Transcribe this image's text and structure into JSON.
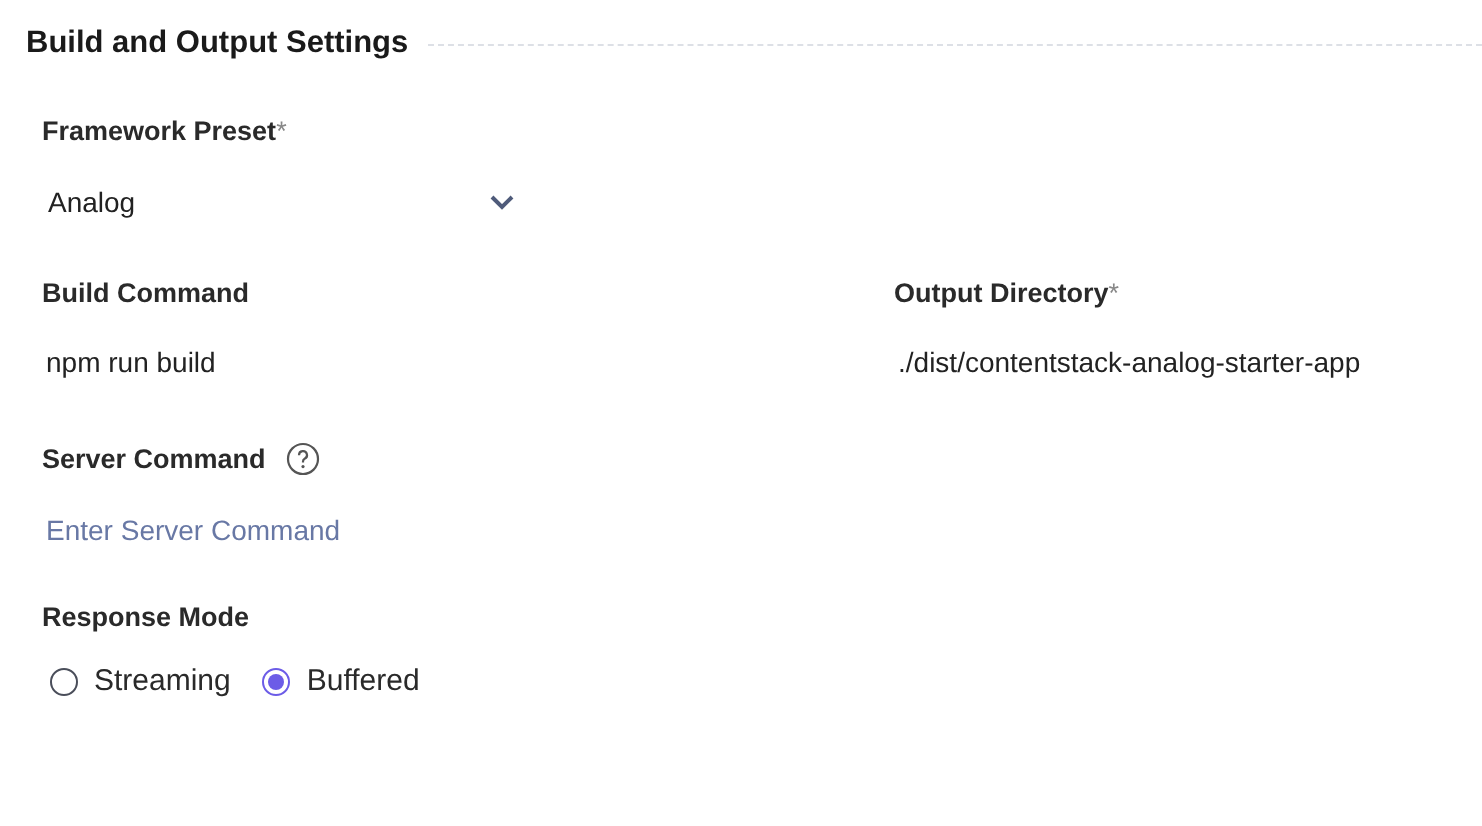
{
  "section": {
    "title": "Build and Output Settings"
  },
  "framework_preset": {
    "label": "Framework Preset",
    "required_mark": "*",
    "value": "Analog"
  },
  "build_command": {
    "label": "Build Command",
    "value": "npm run build"
  },
  "output_directory": {
    "label": "Output Directory",
    "required_mark": "*",
    "value": "./dist/contentstack-analog-starter-app"
  },
  "server_command": {
    "label": "Server Command",
    "placeholder": "Enter Server Command"
  },
  "response_mode": {
    "label": "Response Mode",
    "options": [
      {
        "label": "Streaming",
        "selected": false
      },
      {
        "label": "Buffered",
        "selected": true
      }
    ]
  }
}
